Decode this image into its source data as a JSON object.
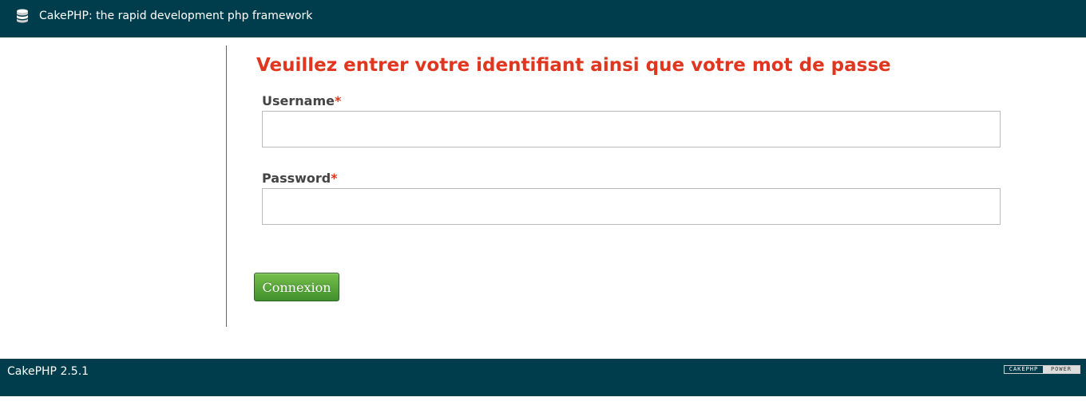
{
  "header": {
    "logo_icon": "cake-stack-icon",
    "title": "CakePHP: the rapid development php framework"
  },
  "form": {
    "heading": "Veuillez entrer votre identifiant ainsi que votre mot de passe",
    "username": {
      "label": "Username",
      "required_mark": "*",
      "value": "",
      "placeholder": ""
    },
    "password": {
      "label": "Password",
      "required_mark": "*",
      "value": "",
      "placeholder": ""
    },
    "submit_label": "Connexion"
  },
  "footer": {
    "version": "CakePHP 2.5.1",
    "badge_left": "CAKEPHP",
    "badge_right": "POWER",
    "cut_text": "... ..."
  },
  "colors": {
    "header_bg": "#003d4c",
    "footer_bg": "#003d4c",
    "heading_text": "#e0361f",
    "required_mark": "#e0361f",
    "button_green": "#4a9a32"
  }
}
